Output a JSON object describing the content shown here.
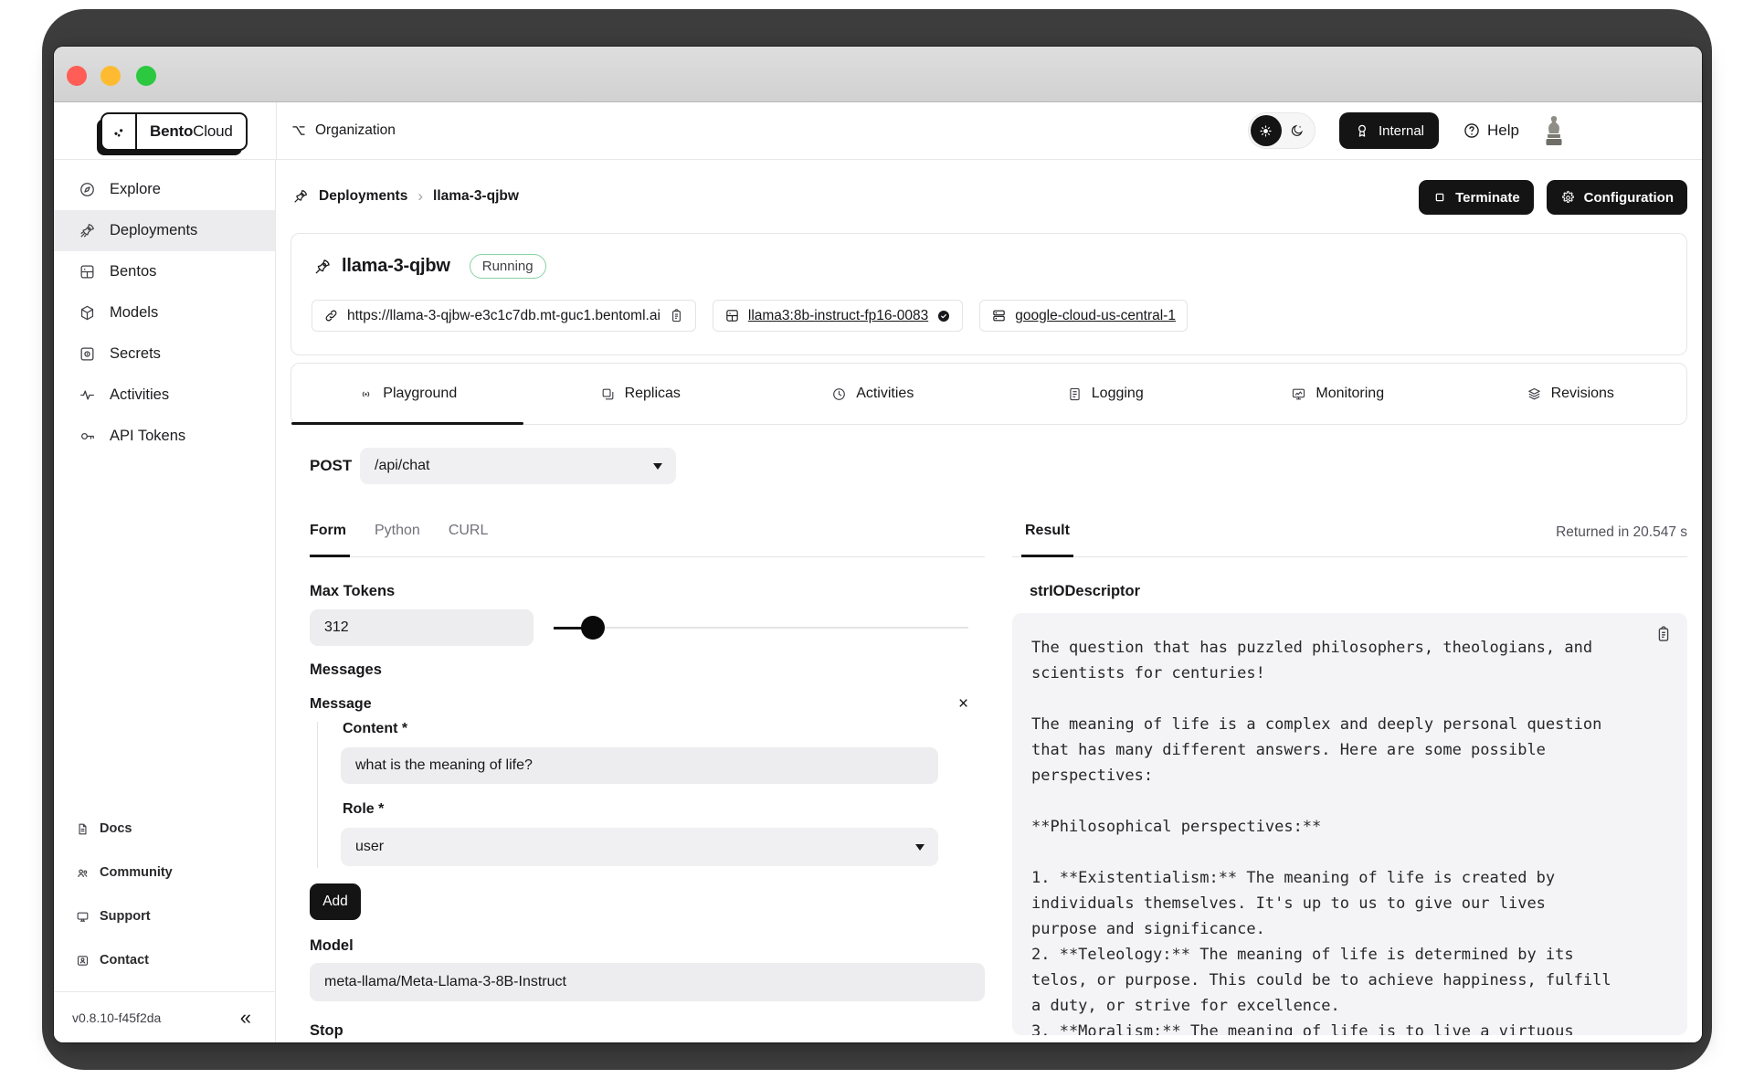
{
  "header": {
    "brand_bold": "Bento",
    "brand_light": "Cloud",
    "organization": "Organization",
    "internal": "Internal",
    "help": "Help"
  },
  "sidebar": {
    "items": [
      {
        "icon": "compass",
        "label": "Explore"
      },
      {
        "icon": "rocket",
        "label": "Deployments"
      },
      {
        "icon": "bento-box",
        "label": "Bentos"
      },
      {
        "icon": "cube",
        "label": "Models"
      },
      {
        "icon": "vault",
        "label": "Secrets"
      },
      {
        "icon": "pulse",
        "label": "Activities"
      },
      {
        "icon": "key",
        "label": "API Tokens"
      }
    ],
    "links": [
      {
        "icon": "document",
        "label": "Docs"
      },
      {
        "icon": "people",
        "label": "Community"
      },
      {
        "icon": "monitor",
        "label": "Support"
      },
      {
        "icon": "contact-card",
        "label": "Contact"
      }
    ],
    "version": "v0.8.10-f45f2da"
  },
  "toolbar": {
    "breadcrumb_parent": "Deployments",
    "breadcrumb_separator": "›",
    "breadcrumb_current": "llama-3-qjbw",
    "terminate": "Terminate",
    "configuration": "Configuration"
  },
  "deployment": {
    "name": "llama-3-qjbw",
    "status": "Running",
    "endpoint_url": "https://llama-3-qjbw-e3c1c7db.mt-guc1.bentoml.ai",
    "bento_tag": "llama3:8b-instruct-fp16-0083",
    "cluster": "google-cloud-us-central-1"
  },
  "tabs": [
    {
      "label": "Playground"
    },
    {
      "label": "Replicas"
    },
    {
      "label": "Activities"
    },
    {
      "label": "Logging"
    },
    {
      "label": "Monitoring"
    },
    {
      "label": "Revisions"
    }
  ],
  "playground": {
    "method": "POST",
    "endpoint": "/api/chat",
    "code_tabs": [
      {
        "label": "Form"
      },
      {
        "label": "Python"
      },
      {
        "label": "CURL"
      }
    ],
    "form": {
      "max_tokens_label": "Max Tokens",
      "max_tokens_value": "312",
      "messages_label": "Messages",
      "message_label": "Message",
      "close_glyph": "×",
      "content_label": "Content *",
      "content_value": "what is the meaning of life?",
      "role_label": "Role *",
      "role_value": "user",
      "add": "Add",
      "model_label": "Model",
      "model_value": "meta-llama/Meta-Llama-3-8B-Instruct",
      "stop_label": "Stop"
    },
    "result": {
      "tab": "Result",
      "returned": "Returned in 20.547 s",
      "descriptor": "strIODescriptor",
      "output": "The question that has puzzled philosophers, theologians, and\nscientists for centuries!\n\nThe meaning of life is a complex and deeply personal question\nthat has many different answers. Here are some possible\nperspectives:\n\n**Philosophical perspectives:**\n\n1. **Existentialism:** The meaning of life is created by\nindividuals themselves. It's up to us to give our lives\npurpose and significance.\n2. **Teleology:** The meaning of life is determined by its\ntelos, or purpose. This could be to achieve happiness, fulfill\na duty, or strive for excellence.\n3. **Moralism:** The meaning of life is to live a virtuous"
    }
  },
  "footer_misc": {
    "collapse_glyph": "«"
  },
  "colors": {
    "accent_black": "#141414",
    "running_green": "#86d3a2",
    "input_gray": "#ededf0",
    "result_bg": "#f4f4f6",
    "frame_dark": "#3d3d3d"
  }
}
